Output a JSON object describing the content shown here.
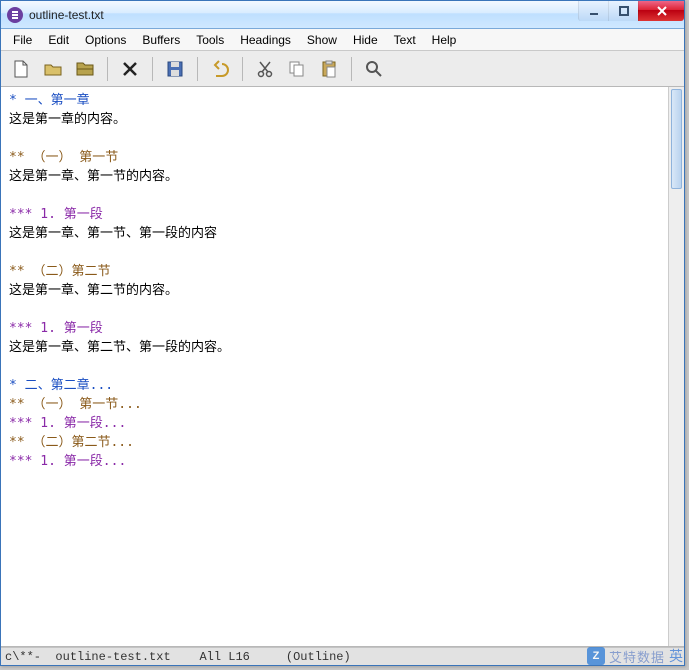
{
  "window": {
    "title": "outline-test.txt"
  },
  "menu": {
    "items": [
      "File",
      "Edit",
      "Options",
      "Buffers",
      "Tools",
      "Headings",
      "Show",
      "Hide",
      "Text",
      "Help"
    ]
  },
  "toolbar": {
    "icons": [
      "new-file-icon",
      "open-file-icon",
      "dired-icon",
      "close-icon",
      "save-icon",
      "undo-icon",
      "cut-icon",
      "copy-icon",
      "paste-icon",
      "search-icon"
    ]
  },
  "outline": [
    {
      "level": 1,
      "stars": "*",
      "heading": " 一、第一章",
      "body": "这是第一章的内容。"
    },
    {
      "level": 2,
      "stars": "**",
      "heading": " （一） 第一节",
      "body": "这是第一章、第一节的内容。"
    },
    {
      "level": 3,
      "stars": "***",
      "heading": " 1. 第一段",
      "body": "这是第一章、第一节、第一段的内容"
    },
    {
      "level": 2,
      "stars": "**",
      "heading": " （二）第二节",
      "body": "这是第一章、第二节的内容。"
    },
    {
      "level": 3,
      "stars": "***",
      "heading": " 1. 第一段",
      "body": "这是第一章、第二节、第一段的内容。"
    },
    {
      "level": 1,
      "stars": "*",
      "heading": " 二、第二章...",
      "body": null
    },
    {
      "level": 2,
      "stars": "**",
      "heading": " （一） 第一节...",
      "body": null
    },
    {
      "level": 3,
      "stars": "***",
      "heading": " 1. 第一段...",
      "body": null
    },
    {
      "level": 2,
      "stars": "**",
      "heading": " （二）第二节...",
      "body": null
    },
    {
      "level": 3,
      "stars": "***",
      "heading": " 1. 第一段...",
      "body": null
    }
  ],
  "status": {
    "left": "c\\**-",
    "buffer": "outline-test.txt",
    "position": "All L16",
    "mode": "(Outline)"
  },
  "watermark": {
    "badge": "Z",
    "text": "艾特数据",
    "tail": "英"
  }
}
